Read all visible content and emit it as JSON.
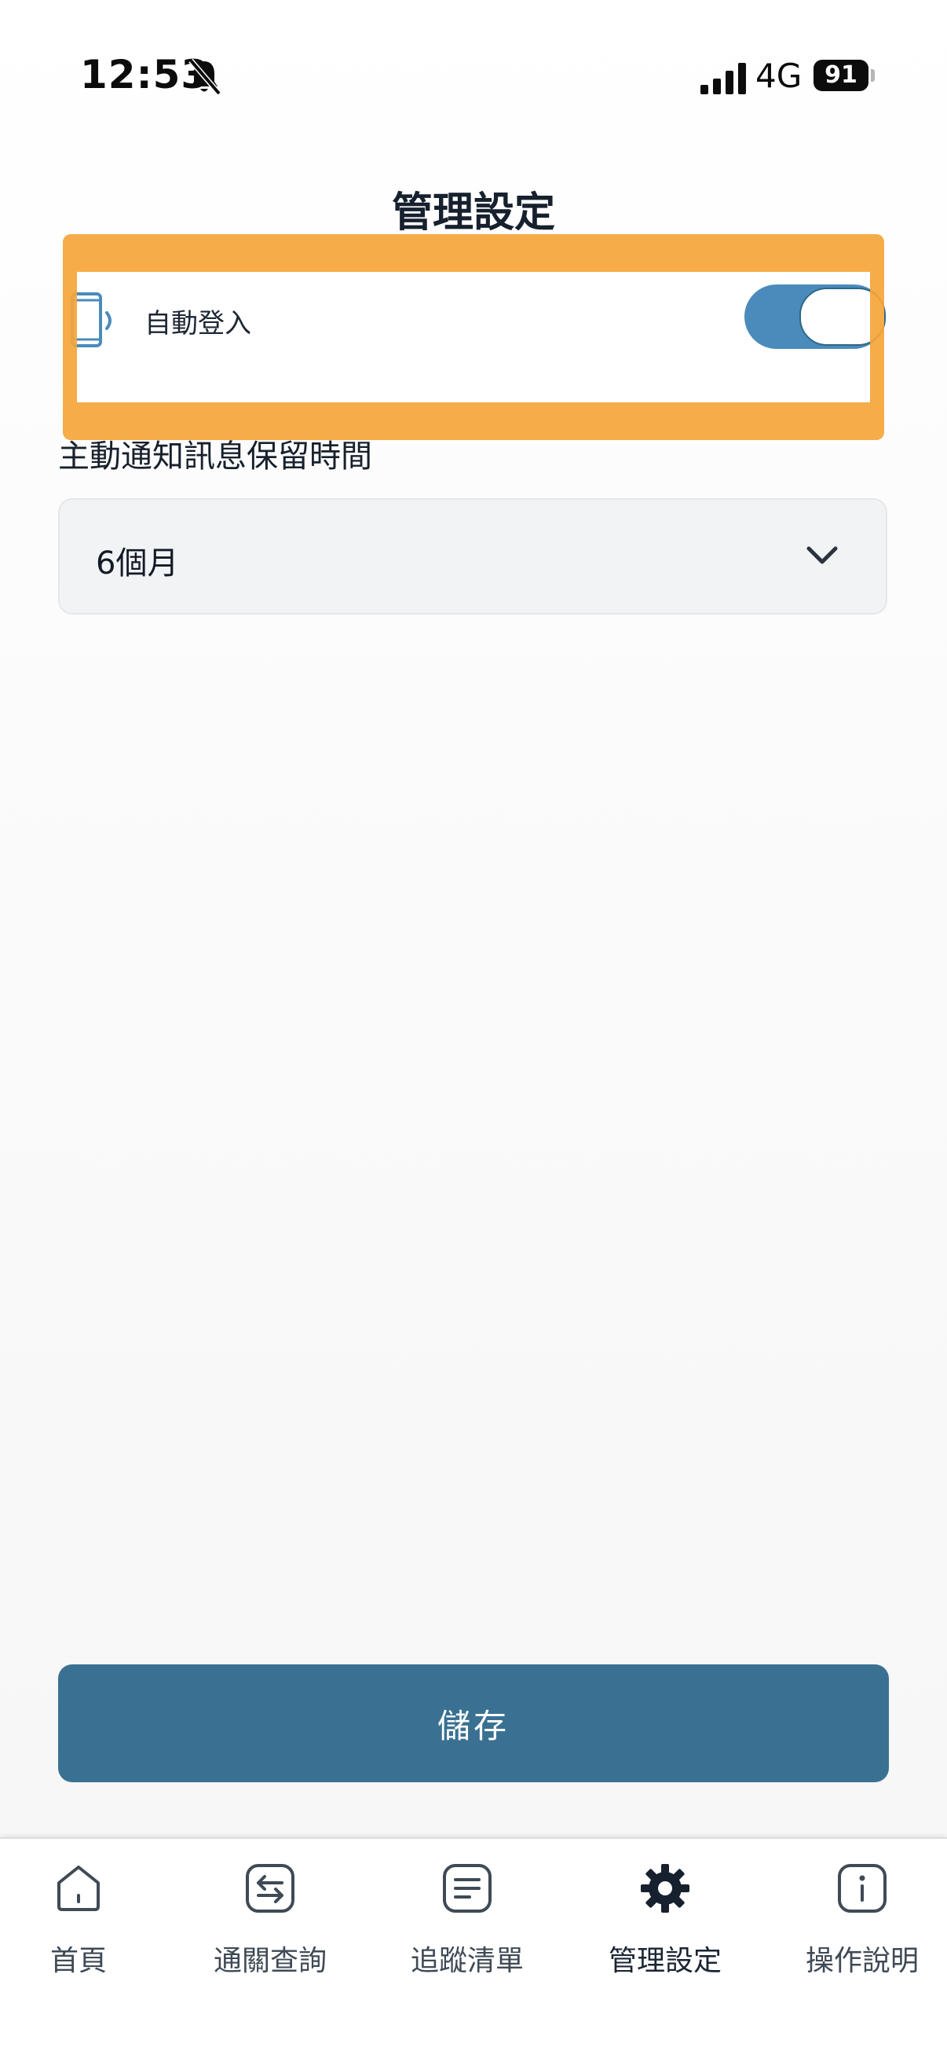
{
  "status_bar": {
    "time": "12:53",
    "network": "4G",
    "battery": "91"
  },
  "header": {
    "title": "管理設定"
  },
  "auto_login": {
    "label": "自動登入",
    "enabled": true
  },
  "retention": {
    "label": "主動通知訊息保留時間",
    "selected": "6個月"
  },
  "save_label": "儲存",
  "nav": {
    "items": [
      {
        "label": "首頁",
        "icon": "home-icon"
      },
      {
        "label": "通關查詢",
        "icon": "swap-icon"
      },
      {
        "label": "追蹤清單",
        "icon": "list-icon"
      },
      {
        "label": "管理設定",
        "icon": "gear-icon",
        "active": true
      },
      {
        "label": "操作說明",
        "icon": "info-icon"
      }
    ]
  },
  "colors": {
    "primary": "#3a7192",
    "toggle_on": "#4a8bbb",
    "highlight": "#f5a53a"
  }
}
